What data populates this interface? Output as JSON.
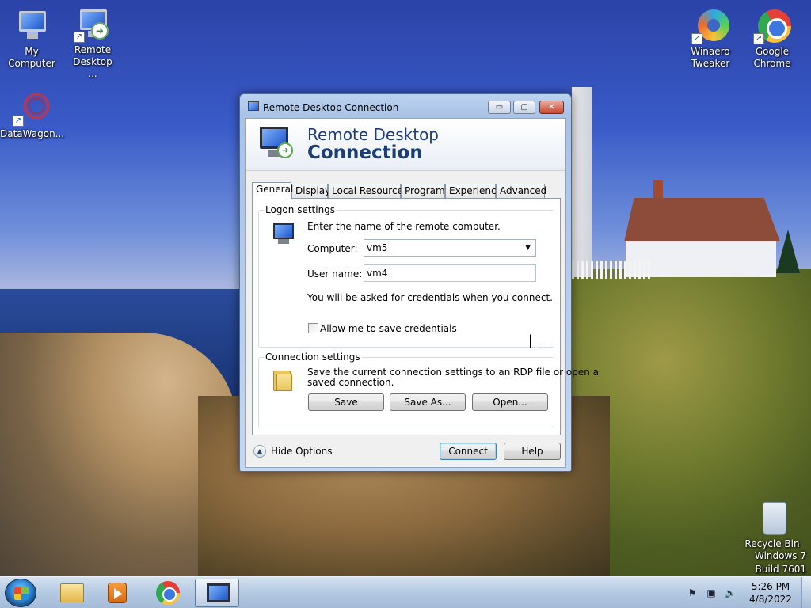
{
  "desktop": {
    "icons": {
      "my_computer": "My Computer",
      "remote_desktop": "Remote Desktop ...",
      "datawagon": "DataWagon...",
      "winaero_line1": "Winaero",
      "winaero_line2": "Tweaker",
      "chrome_line1": "Google",
      "chrome_line2": "Chrome",
      "recycle_bin": "Recycle Bin"
    },
    "watermark": {
      "line1": "Windows 7",
      "line2": "Build 7601"
    }
  },
  "window": {
    "title": "Remote Desktop Connection",
    "controls": {
      "minimize": "▭",
      "maximize": "▢",
      "close": "✕"
    },
    "banner": {
      "line1": "Remote Desktop",
      "line2": "Connection"
    },
    "tabs": [
      {
        "label": "General",
        "active": true
      },
      {
        "label": "Display",
        "active": false
      },
      {
        "label": "Local Resources",
        "active": false
      },
      {
        "label": "Programs",
        "active": false
      },
      {
        "label": "Experience",
        "active": false
      },
      {
        "label": "Advanced",
        "active": false
      }
    ],
    "logon": {
      "group_label": "Logon settings",
      "instruction": "Enter the name of the remote computer.",
      "computer_label": "Computer:",
      "computer_value": "vm5",
      "username_label": "User name:",
      "username_value": "vm4",
      "credentials_note": "You will be asked for credentials when you connect.",
      "save_credentials_label": "Allow me to save credentials",
      "save_credentials_checked": false
    },
    "connection": {
      "group_label": "Connection settings",
      "description_line1": "Save the current connection settings to an RDP file or open a",
      "description_line2": "saved connection.",
      "save_button": "Save",
      "save_as_button": "Save As...",
      "open_button": "Open..."
    },
    "footer": {
      "hide_options": "Hide Options",
      "connect_button": "Connect",
      "help_button": "Help"
    }
  },
  "taskbar": {
    "time": "5:26 PM",
    "date": "4/8/2022",
    "pinned": [
      "start-button",
      "windows-explorer",
      "media-player",
      "google-chrome",
      "remote-desktop-connection"
    ],
    "active_app": "remote-desktop-connection",
    "tray_icons": [
      "action-center-icon",
      "network-icon",
      "volume-icon"
    ]
  },
  "colors": {
    "banner_text": "#1b3d7a",
    "window_frame": "#a8c2e6",
    "close_button": "#c8452b",
    "default_button_border": "#3c7fb1"
  }
}
